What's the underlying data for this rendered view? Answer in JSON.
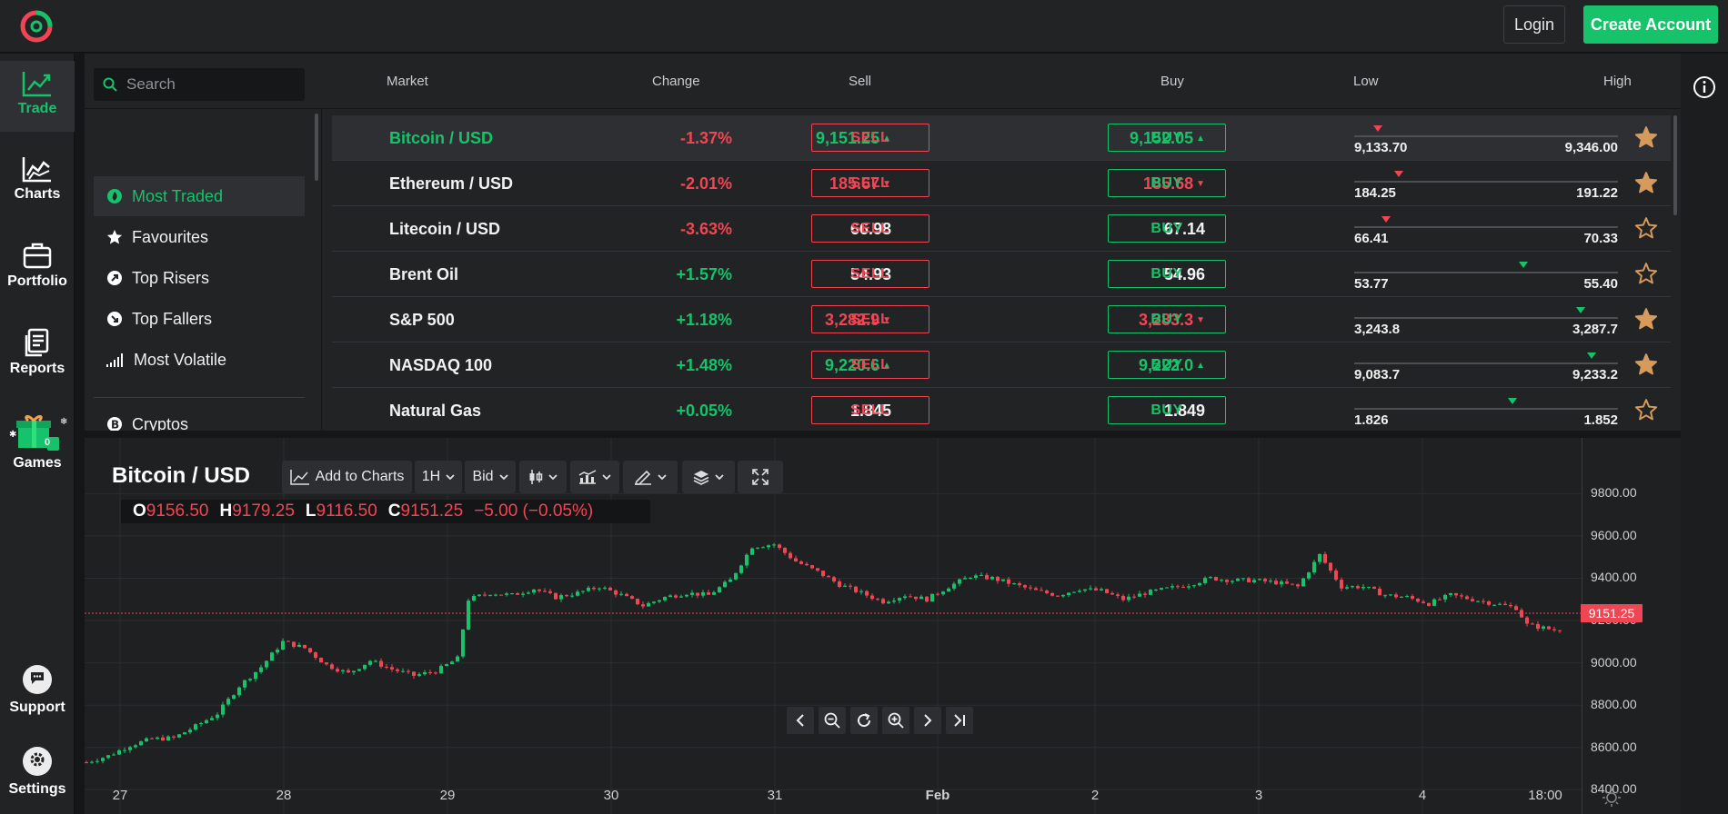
{
  "header": {
    "login_label": "Login",
    "create_account_label": "Create Account",
    "brand_colors": {
      "accent_green": "#16c36a",
      "accent_red": "#f04654"
    }
  },
  "sidebar": {
    "items": [
      {
        "label": "Trade",
        "icon": "trending-up-icon",
        "active": true
      },
      {
        "label": "Charts",
        "icon": "chart-line-icon"
      },
      {
        "label": "Portfolio",
        "icon": "briefcase-icon"
      },
      {
        "label": "Reports",
        "icon": "document-icon"
      },
      {
        "label": "Games",
        "icon": "gift-icon",
        "badge": "0"
      },
      {
        "label": "Support",
        "icon": "chat-icon"
      },
      {
        "label": "Settings",
        "icon": "gear-icon"
      }
    ]
  },
  "search": {
    "placeholder": "Search"
  },
  "columns": {
    "market": "Market",
    "change": "Change",
    "sell": "Sell",
    "buy": "Buy",
    "low": "Low",
    "high": "High"
  },
  "categories": [
    {
      "label": "Most Traded",
      "icon": "flame-icon",
      "active": true
    },
    {
      "label": "Favourites",
      "icon": "star-icon"
    },
    {
      "label": "Top Risers",
      "icon": "arrow-up-right-icon"
    },
    {
      "label": "Top Fallers",
      "icon": "arrow-down-right-icon"
    },
    {
      "label": "Most Volatile",
      "icon": "signal-bars-icon"
    },
    {
      "label": "Cryptos",
      "icon": "bitcoin-icon"
    }
  ],
  "markets": [
    {
      "name": "Bitcoin / USD",
      "change": "-1.37%",
      "sell": "9,151.25",
      "buy": "9,152.05",
      "price_dir": "up",
      "price_color": "green",
      "low": "9,133.70",
      "high": "9,346.00",
      "range_pos": 0.09,
      "range_dir": "down",
      "favourite": true,
      "selected": true
    },
    {
      "name": "Ethereum / USD",
      "change": "-2.01%",
      "sell": "185.67",
      "buy": "185.68",
      "price_dir": "down",
      "price_color": "red",
      "low": "184.25",
      "high": "191.22",
      "range_pos": 0.17,
      "range_dir": "down",
      "favourite": true
    },
    {
      "name": "Litecoin / USD",
      "change": "-3.63%",
      "sell": "66.98",
      "buy": "67.14",
      "price_dir": "none",
      "price_color": "white",
      "low": "66.41",
      "high": "70.33",
      "range_pos": 0.12,
      "range_dir": "down",
      "favourite": false
    },
    {
      "name": "Brent Oil",
      "change": "+1.57%",
      "sell": "54.93",
      "buy": "54.96",
      "price_dir": "none",
      "price_color": "white",
      "low": "53.77",
      "high": "55.40",
      "range_pos": 0.64,
      "range_dir": "up",
      "favourite": false
    },
    {
      "name": "S&P 500",
      "change": "+1.18%",
      "sell": "3,282.9",
      "buy": "3,283.3",
      "price_dir": "down",
      "price_color": "red",
      "low": "3,243.8",
      "high": "3,287.7",
      "range_pos": 0.86,
      "range_dir": "up",
      "favourite": true
    },
    {
      "name": "NASDAQ 100",
      "change": "+1.48%",
      "sell": "9,220.6",
      "buy": "9,222.0",
      "price_dir": "up",
      "price_color": "green",
      "low": "9,083.7",
      "high": "9,233.2",
      "range_pos": 0.9,
      "range_dir": "up",
      "favourite": true
    },
    {
      "name": "Natural Gas",
      "change": "+0.05%",
      "sell": "1.845",
      "buy": "1.849",
      "price_dir": "none",
      "price_color": "white",
      "low": "1.826",
      "high": "1.852",
      "range_pos": 0.6,
      "range_dir": "up",
      "favourite": false
    }
  ],
  "trade_buttons": {
    "sell": "SELL",
    "buy": "BUY"
  },
  "chart": {
    "title": "Bitcoin / USD",
    "toolbar": {
      "add_to_charts": "Add to Charts",
      "interval": "1H",
      "price_type": "Bid"
    },
    "ohlc": {
      "o_label": "O",
      "o": "9156.50",
      "h_label": "H",
      "h": "9179.25",
      "l_label": "L",
      "l": "9116.50",
      "c_label": "C",
      "c": "9151.25",
      "change": "−5.00 (−0.05%)"
    },
    "current_price_label": "9151.25"
  },
  "chart_data": {
    "type": "candlestick",
    "title": "Bitcoin / USD",
    "interval": "1H",
    "y_ticks": [
      "9800.00",
      "9600.00",
      "9400.00",
      "9200.00",
      "9000.00",
      "8800.00",
      "8600.00",
      "8400.00"
    ],
    "ylim": [
      8380,
      9840
    ],
    "x_ticks": [
      "27",
      "28",
      "29",
      "30",
      "31",
      "Feb",
      "2",
      "3",
      "4",
      "18:00"
    ],
    "current_price": 9151.25,
    "grid": true,
    "close_path": [
      [
        0,
        8530
      ],
      [
        4,
        8560
      ],
      [
        8,
        8610
      ],
      [
        12,
        8640
      ],
      [
        16,
        8645
      ],
      [
        20,
        8700
      ],
      [
        24,
        8760
      ],
      [
        28,
        8890
      ],
      [
        32,
        8980
      ],
      [
        36,
        9100
      ],
      [
        40,
        9070
      ],
      [
        44,
        8990
      ],
      [
        48,
        8950
      ],
      [
        52,
        9010
      ],
      [
        56,
        8970
      ],
      [
        60,
        8940
      ],
      [
        64,
        8960
      ],
      [
        68,
        9020
      ],
      [
        70,
        9300
      ],
      [
        74,
        9330
      ],
      [
        78,
        9320
      ],
      [
        82,
        9350
      ],
      [
        86,
        9310
      ],
      [
        90,
        9330
      ],
      [
        94,
        9360
      ],
      [
        98,
        9320
      ],
      [
        102,
        9270
      ],
      [
        106,
        9310
      ],
      [
        110,
        9330
      ],
      [
        114,
        9320
      ],
      [
        118,
        9390
      ],
      [
        122,
        9550
      ],
      [
        126,
        9560
      ],
      [
        130,
        9480
      ],
      [
        134,
        9430
      ],
      [
        138,
        9370
      ],
      [
        142,
        9330
      ],
      [
        146,
        9290
      ],
      [
        150,
        9320
      ],
      [
        154,
        9300
      ],
      [
        158,
        9360
      ],
      [
        162,
        9410
      ],
      [
        166,
        9400
      ],
      [
        170,
        9370
      ],
      [
        174,
        9340
      ],
      [
        178,
        9320
      ],
      [
        182,
        9350
      ],
      [
        186,
        9340
      ],
      [
        190,
        9300
      ],
      [
        194,
        9330
      ],
      [
        198,
        9350
      ],
      [
        202,
        9370
      ],
      [
        206,
        9400
      ],
      [
        210,
        9390
      ],
      [
        214,
        9390
      ],
      [
        218,
        9380
      ],
      [
        222,
        9360
      ],
      [
        226,
        9510
      ],
      [
        230,
        9360
      ],
      [
        234,
        9360
      ],
      [
        238,
        9320
      ],
      [
        242,
        9310
      ],
      [
        246,
        9280
      ],
      [
        250,
        9320
      ],
      [
        254,
        9300
      ],
      [
        258,
        9280
      ],
      [
        262,
        9260
      ],
      [
        264,
        9180
      ],
      [
        268,
        9160
      ],
      [
        270,
        9151
      ]
    ]
  }
}
